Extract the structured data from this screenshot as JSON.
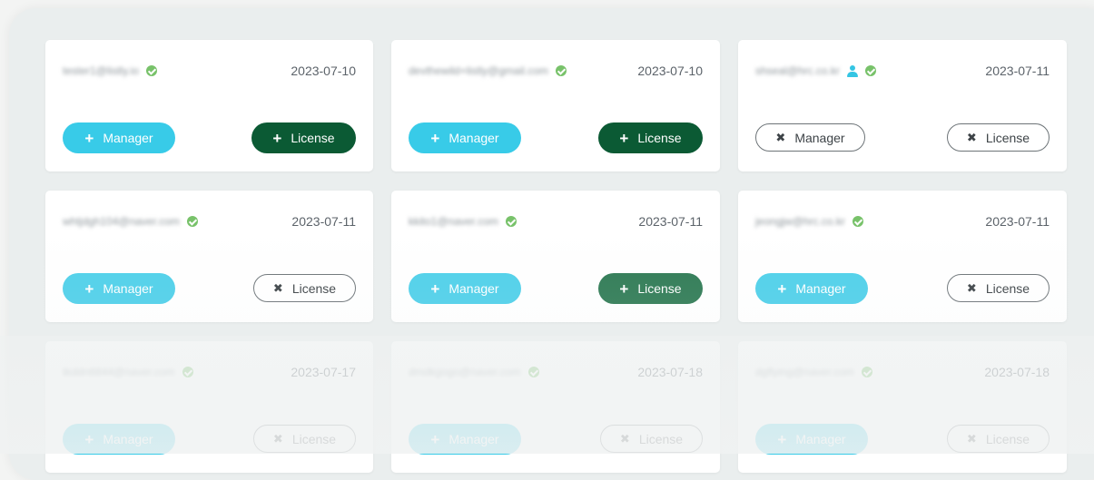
{
  "cards": [
    {
      "email": "tester1@listly.io",
      "admin": false,
      "date": "2023-07-10",
      "manager": {
        "label": "Manager",
        "state": "add"
      },
      "license": {
        "label": "License",
        "state": "add"
      }
    },
    {
      "email": "devthewild+listly@gmail.com",
      "admin": false,
      "date": "2023-07-10",
      "manager": {
        "label": "Manager",
        "state": "add"
      },
      "license": {
        "label": "License",
        "state": "add"
      }
    },
    {
      "email": "shseal@hrc.co.kr",
      "admin": true,
      "date": "2023-07-11",
      "manager": {
        "label": "Manager",
        "state": "remove"
      },
      "license": {
        "label": "License",
        "state": "remove"
      }
    },
    {
      "email": "whtjdgh104@naver.com",
      "admin": false,
      "date": "2023-07-11",
      "manager": {
        "label": "Manager",
        "state": "add"
      },
      "license": {
        "label": "License",
        "state": "remove"
      }
    },
    {
      "email": "kkito1@naver.com",
      "admin": false,
      "date": "2023-07-11",
      "manager": {
        "label": "Manager",
        "state": "add"
      },
      "license": {
        "label": "License",
        "state": "add"
      }
    },
    {
      "email": "jeongjw@hrc.co.kr",
      "admin": false,
      "date": "2023-07-11",
      "manager": {
        "label": "Manager",
        "state": "add"
      },
      "license": {
        "label": "License",
        "state": "remove"
      }
    },
    {
      "email": "tkddn6844@naver.com",
      "admin": false,
      "date": "2023-07-17",
      "manager": {
        "label": "Manager",
        "state": "add"
      },
      "license": {
        "label": "License",
        "state": "remove"
      }
    },
    {
      "email": "dmdkgogo@naver.com",
      "admin": false,
      "date": "2023-07-18",
      "manager": {
        "label": "Manager",
        "state": "add"
      },
      "license": {
        "label": "License",
        "state": "remove"
      }
    },
    {
      "email": "dgflying@naver.com",
      "admin": false,
      "date": "2023-07-18",
      "manager": {
        "label": "Manager",
        "state": "add"
      },
      "license": {
        "label": "License",
        "state": "remove"
      }
    }
  ],
  "glyphs": {
    "add": "+",
    "remove": "✖"
  },
  "colors": {
    "manager_active": "#38cbe8",
    "license_active": "#0b5a34",
    "verified": "#78c26a",
    "admin_icon": "#35c5e3"
  }
}
